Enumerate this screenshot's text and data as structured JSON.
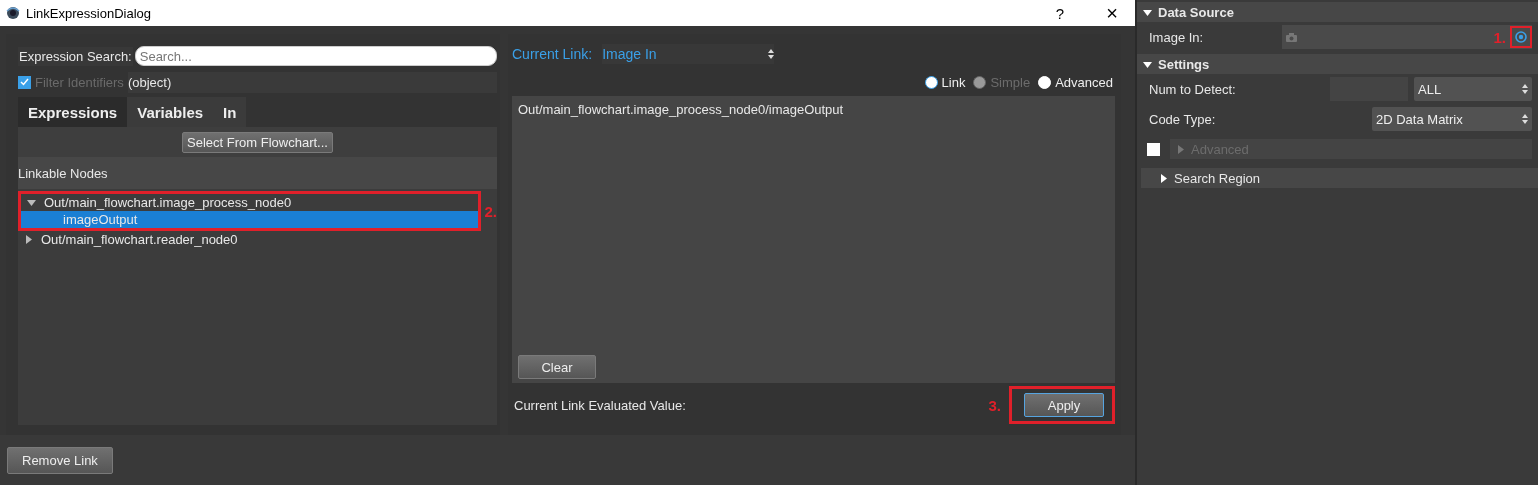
{
  "dialog": {
    "title": "LinkExpressionDialog",
    "help": "?",
    "close": "×"
  },
  "search": {
    "label": "Expression Search:",
    "placeholder": "Search..."
  },
  "filter": {
    "label": "Filter Identifiers",
    "checked": true,
    "type_text": "(object)"
  },
  "tabs": [
    {
      "label": "Expressions",
      "selected": true
    },
    {
      "label": "Variables",
      "selected": false
    },
    {
      "label": "In",
      "selected": false
    }
  ],
  "select_button": "Select From Flowchart...",
  "nodes_header": "Linkable Nodes",
  "tree": [
    {
      "label": "Out/main_flowchart.image_process_node0",
      "expanded": true,
      "selected": false,
      "annotation": "2.",
      "children": [
        {
          "label": "imageOutput",
          "selected": true
        }
      ]
    },
    {
      "label": "Out/main_flowchart.reader_node0",
      "expanded": false,
      "selected": false
    }
  ],
  "current_link": {
    "label": "Current Link:",
    "value": "Image In"
  },
  "modes": [
    {
      "label": "Link",
      "selected": true,
      "disabled": false
    },
    {
      "label": "Simple",
      "selected": false,
      "disabled": true
    },
    {
      "label": "Advanced",
      "selected": false,
      "disabled": false
    }
  ],
  "expression": "Out/main_flowchart.image_process_node0/imageOutput",
  "clear_button": "Clear",
  "evaluated_label": "Current Link Evaluated Value:",
  "apply_button": {
    "label": "Apply",
    "annotation": "3."
  },
  "remove_button": "Remove Link",
  "properties": [
    {
      "title": "Data Source",
      "expanded": true,
      "rows": [
        {
          "kind": "image-input",
          "label": "Image In:",
          "annotation": "1."
        }
      ]
    },
    {
      "title": "Settings",
      "expanded": true,
      "rows": [
        {
          "kind": "spin-combo",
          "label": "Num to Detect:",
          "value": "ALL"
        },
        {
          "kind": "combo",
          "label": "Code Type:",
          "value": "2D Data Matrix"
        },
        {
          "kind": "group",
          "label": "Advanced",
          "checked": false,
          "disabled": true
        },
        {
          "kind": "subsection",
          "label": "Search Region",
          "expanded": false
        }
      ]
    }
  ]
}
